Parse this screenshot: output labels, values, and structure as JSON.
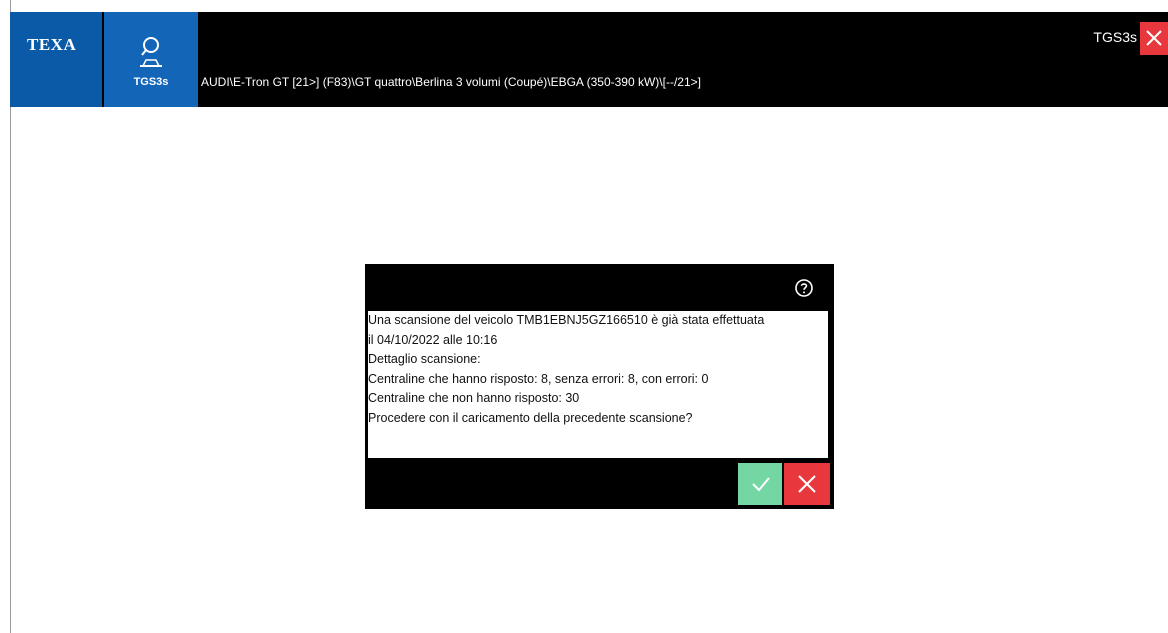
{
  "header": {
    "logo_text": "TEXA",
    "tool_label": "TGS3s",
    "breadcrumb": "AUDI\\E-Tron GT [21>] (F83)\\GT quattro\\Berlina 3 volumi (Coupé)\\EBGA (350-390 kW)\\[--/21>]",
    "app_name": "TGS3s"
  },
  "dialog": {
    "lines": [
      "Una scansione del veicolo TMB1EBNJ5GZ166510 è già stata effettuata",
      "il 04/10/2022 alle 10:16",
      "Dettaglio scansione:",
      "Centraline che hanno risposto: 8, senza errori: 8, con errori: 0",
      "Centraline che non hanno risposto: 30",
      "Procedere con il caricamento della precedente scansione?"
    ]
  },
  "icons": {
    "tool": "search-vehicle-icon",
    "close": "close-icon",
    "help": "help-circle-icon",
    "confirm": "check-icon",
    "cancel": "close-icon"
  },
  "colors": {
    "topbar": "#000000",
    "logo_bg": "#0a5aa8",
    "tool_bg": "#1265b7",
    "confirm": "#74d6a3",
    "cancel": "#e8383d"
  }
}
